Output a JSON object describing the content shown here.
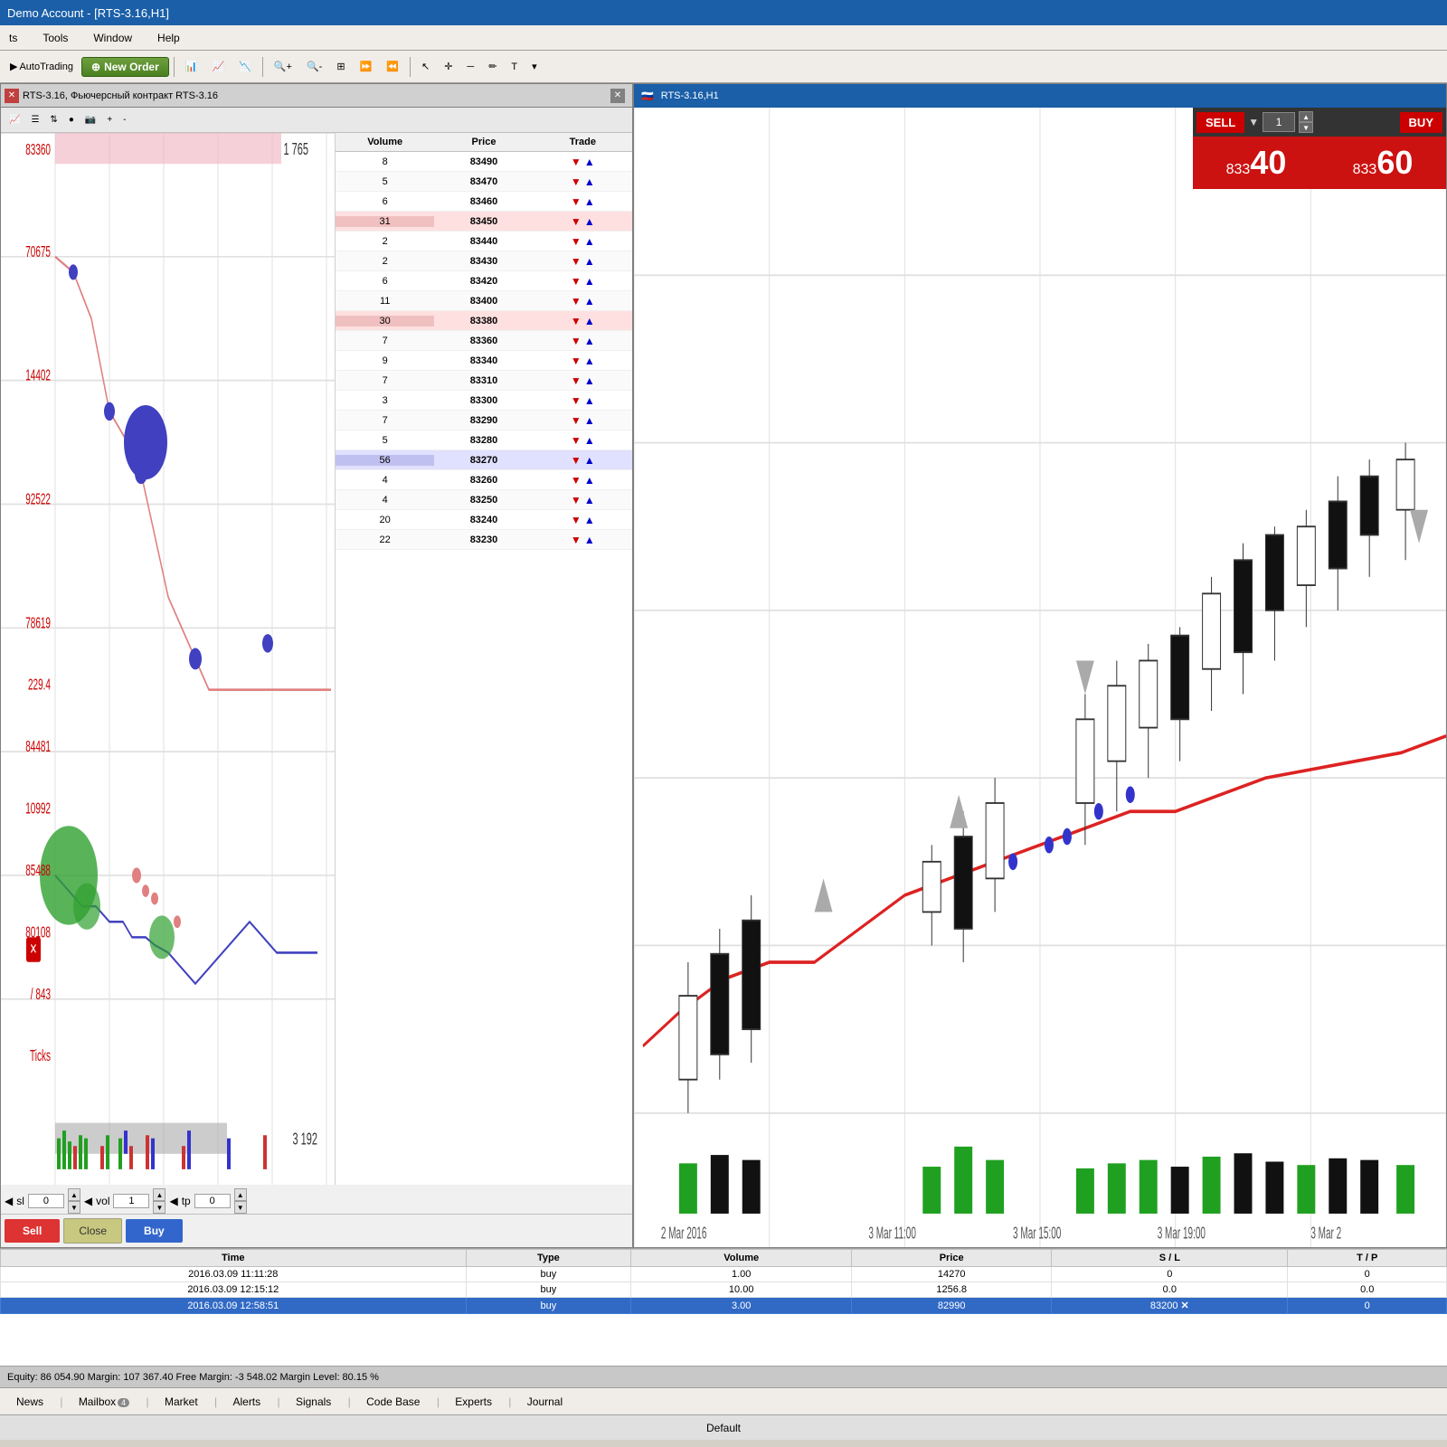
{
  "titleBar": {
    "text": "Demo Account - [RTS-3.16,H1]"
  },
  "menuBar": {
    "items": [
      "ts",
      "Tools",
      "Window",
      "Help"
    ]
  },
  "toolbar": {
    "autoTrading": "AutoTrading",
    "newOrder": "New Order"
  },
  "leftPanel": {
    "title": "RTS-3.16, Фьючерсный контракт RTS-3.16",
    "priceLabels": [
      "83360",
      "70675",
      "14402",
      "92522",
      "78619",
      "229.4",
      "84481",
      "10992",
      "85488",
      "80108",
      "/ 843",
      "Ticks"
    ],
    "volume1765": "1 765",
    "volume3192": "3 192",
    "orderBook": {
      "headers": [
        "Volume",
        "Price",
        "Trade"
      ],
      "rows": [
        {
          "volume": "8",
          "price": "83490",
          "highlighted": false
        },
        {
          "volume": "5",
          "price": "83470",
          "highlighted": false
        },
        {
          "volume": "6",
          "price": "83460",
          "highlighted": false
        },
        {
          "volume": "31",
          "price": "83450",
          "highlighted": "ask"
        },
        {
          "volume": "2",
          "price": "83440",
          "highlighted": false
        },
        {
          "volume": "2",
          "price": "83430",
          "highlighted": false
        },
        {
          "volume": "6",
          "price": "83420",
          "highlighted": false
        },
        {
          "volume": "11",
          "price": "83400",
          "highlighted": false
        },
        {
          "volume": "30",
          "price": "83380",
          "highlighted": "ask"
        },
        {
          "volume": "7",
          "price": "83360",
          "highlighted": false
        },
        {
          "volume": "9",
          "price": "83340",
          "highlighted": false
        },
        {
          "volume": "7",
          "price": "83310",
          "highlighted": false
        },
        {
          "volume": "3",
          "price": "83300",
          "highlighted": false
        },
        {
          "volume": "7",
          "price": "83290",
          "highlighted": false
        },
        {
          "volume": "5",
          "price": "83280",
          "highlighted": false
        },
        {
          "volume": "56",
          "price": "83270",
          "highlighted": "bid"
        },
        {
          "volume": "4",
          "price": "83260",
          "highlighted": false
        },
        {
          "volume": "4",
          "price": "83250",
          "highlighted": false
        },
        {
          "volume": "20",
          "price": "83240",
          "highlighted": false
        },
        {
          "volume": "22",
          "price": "83230",
          "highlighted": false
        }
      ]
    },
    "slTpRow": {
      "slLabel": "sl",
      "slValue": "0",
      "volLabel": "vol",
      "volValue": "1",
      "tpLabel": "tp",
      "tpValue": "0"
    },
    "buttons": {
      "sell": "Sell",
      "close": "Close",
      "buy": "Buy"
    }
  },
  "rightChart": {
    "header": "RTS-3.16,H1",
    "tradePanel": {
      "sellLabel": "SELL",
      "buyLabel": "BUY",
      "quantity": "1",
      "sellPrice": {
        "small": "833",
        "big": "40"
      },
      "buyPrice": {
        "small": "833",
        "big": "60"
      }
    },
    "xLabels": [
      "2 Mar 2016",
      "3 Mar 11:00",
      "3 Mar 15:00",
      "3 Mar 19:00",
      "3 Mar 2"
    ]
  },
  "tradesTable": {
    "headers": [
      "Time",
      "Type",
      "Volume",
      "Price",
      "S / L",
      "T / P"
    ],
    "rows": [
      {
        "time": "2016.03.09 11:11:28",
        "type": "buy",
        "volume": "1.00",
        "price": "14270",
        "sl": "0",
        "tp": "0",
        "selected": false
      },
      {
        "time": "2016.03.09 12:15:12",
        "type": "buy",
        "volume": "10.00",
        "price": "1256.8",
        "sl": "0.0",
        "tp": "0.0",
        "selected": false
      },
      {
        "time": "2016.03.09 12:58:51",
        "type": "buy",
        "volume": "3.00",
        "price": "82990",
        "sl": "83200",
        "tp": "0",
        "selected": true
      }
    ]
  },
  "statusBar": {
    "text": "Equity: 86 054.90  Margin: 107 367.40  Free Margin: -3 548.02  Margin Level: 80.15 %"
  },
  "bottomTabs": {
    "tabs": [
      {
        "label": "News",
        "badge": null
      },
      {
        "label": "Mailbox",
        "badge": "4"
      },
      {
        "label": "Market",
        "badge": null
      },
      {
        "label": "Alerts",
        "badge": null
      },
      {
        "label": "Signals",
        "badge": null
      },
      {
        "label": "Code Base",
        "badge": null
      },
      {
        "label": "Experts",
        "badge": null
      },
      {
        "label": "Journal",
        "badge": null
      }
    ]
  },
  "bottomStatus": {
    "text": "Default"
  }
}
